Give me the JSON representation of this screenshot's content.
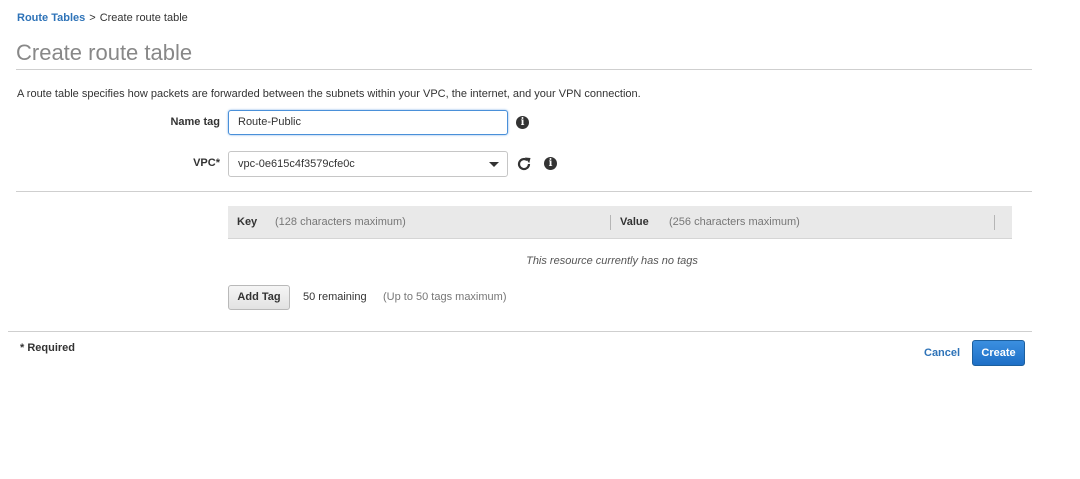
{
  "breadcrumb": {
    "parent": "Route Tables",
    "separator": ">",
    "current": "Create route table"
  },
  "page": {
    "title": "Create route table",
    "description": "A route table specifies how packets are forwarded between the subnets within your VPC, the internet, and your VPN connection."
  },
  "form": {
    "name_tag": {
      "label": "Name tag",
      "value": "Route-Public"
    },
    "vpc": {
      "label": "VPC*",
      "value": "vpc-0e615c4f3579cfe0c"
    }
  },
  "tags": {
    "key_header": "Key",
    "key_hint": "(128 characters maximum)",
    "value_header": "Value",
    "value_hint": "(256 characters maximum)",
    "empty_message": "This resource currently has no tags",
    "add_tag_label": "Add Tag",
    "remaining": "50 remaining",
    "max_hint": "(Up to 50 tags maximum)"
  },
  "footer": {
    "required_note": "* Required",
    "cancel_label": "Cancel",
    "create_label": "Create"
  },
  "icons": {
    "info": "info-icon",
    "refresh": "refresh-icon",
    "dropdown": "chevron-down-icon"
  },
  "colors": {
    "link": "#2e73b8",
    "primary_button": "#1e6fc6",
    "focus_border": "#4a90d9"
  }
}
